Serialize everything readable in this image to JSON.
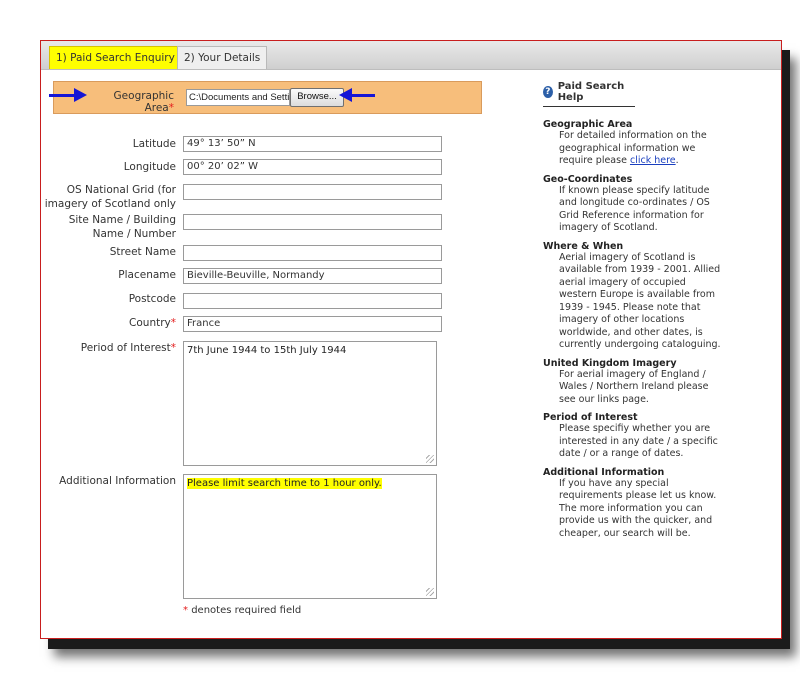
{
  "tabs": [
    {
      "label": "1) Paid Search Enquiry",
      "active": true
    },
    {
      "label": "2) Your Details",
      "active": false
    }
  ],
  "geographic_area": {
    "label": "Geographic Area",
    "required_marker": "*",
    "file_value": "C:\\Documents and Settir",
    "browse_label": "Browse..."
  },
  "form": {
    "latitude": {
      "label": "Latitude",
      "value": "49° 13’ 50” N"
    },
    "longitude": {
      "label": "Longitude",
      "value": "00° 20’ 02” W"
    },
    "os_grid": {
      "label_line1": "OS National Grid (for",
      "label_line2": "imagery of Scotland only",
      "value": ""
    },
    "site_name": {
      "label_line1": "Site Name / Building",
      "label_line2": "Name / Number",
      "value": ""
    },
    "street_name": {
      "label": "Street Name",
      "value": ""
    },
    "placename": {
      "label": "Placename",
      "value": "Bieville-Beuville, Normandy"
    },
    "postcode": {
      "label": "Postcode",
      "value": ""
    },
    "country": {
      "label": "Country",
      "required_marker": "*",
      "value": "France"
    },
    "period": {
      "label": "Period of Interest",
      "required_marker": "*",
      "value": "7th June 1944 to 15th July 1944"
    },
    "additional": {
      "label": "Additional Information",
      "value": "Please limit search time to 1 hour only."
    },
    "required_note_marker": "*",
    "required_note": "denotes required field"
  },
  "help": {
    "title": "Paid Search Help",
    "sections": [
      {
        "head": "Geographic Area",
        "body": "For detailed information on the geographical information we require please",
        "link": "click here",
        "tail": "."
      },
      {
        "head": "Geo-Coordinates",
        "body": "If known please specify latitude and longitude co-ordinates / OS Grid Reference information for imagery of Scotland."
      },
      {
        "head": "Where & When",
        "body": "Aerial imagery of Scotland is available from 1939 - 2001. Allied aerial imagery of occupied western Europe is available from 1939 - 1945. Please note that imagery of other locations worldwide, and other dates, is currently undergoing cataloguing."
      },
      {
        "head": "United Kingdom Imagery",
        "body": "For aerial imagery of England / Wales / Northern Ireland please see our links page."
      },
      {
        "head": "Period of Interest",
        "body": "Please specifiy whether you are interested in any date / a specific date / or a range of dates."
      },
      {
        "head": "Additional Information",
        "body": "If you have any special requirements please let us know. The more information you can provide us with the quicker, and cheaper, our search will be."
      }
    ]
  },
  "colors": {
    "active_tab": "#ffff00",
    "geo_row": "#f7be7b",
    "required": "#e31b1b",
    "arrow": "#1515d6",
    "border": "#c81e1e"
  }
}
